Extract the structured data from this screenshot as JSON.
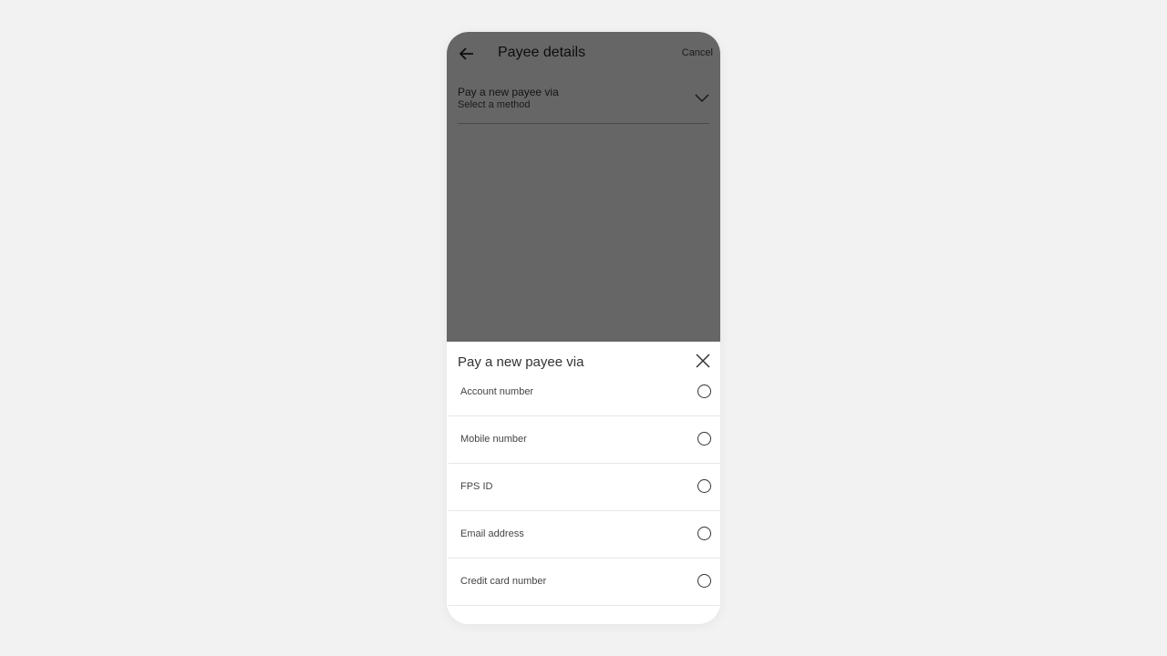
{
  "header": {
    "title": "Payee details",
    "cancel_label": "Cancel",
    "back_icon": "arrow-left-icon"
  },
  "method_select": {
    "label": "Pay a new payee via",
    "value": "Select a method",
    "icon": "chevron-down-icon"
  },
  "sheet": {
    "title": "Pay a new payee via",
    "close_icon": "close-icon",
    "options": [
      {
        "label": "Account number",
        "selected": false
      },
      {
        "label": "Mobile number",
        "selected": false
      },
      {
        "label": "FPS ID",
        "selected": false
      },
      {
        "label": "Email address",
        "selected": false
      },
      {
        "label": "Credit card number",
        "selected": false
      }
    ]
  }
}
